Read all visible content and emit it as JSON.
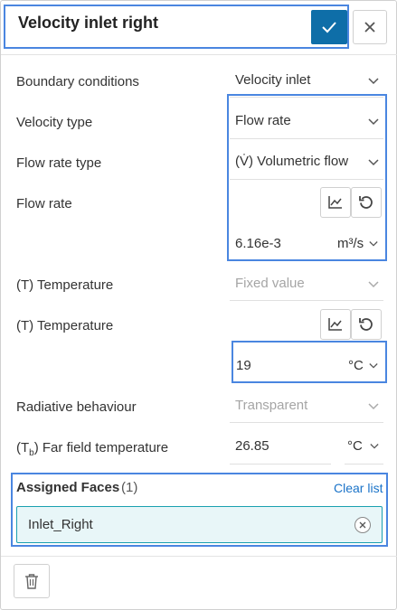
{
  "header": {
    "title": "Velocity inlet right",
    "confirm_icon": "check-icon",
    "close_icon": "close-icon"
  },
  "fields": {
    "boundary_conditions": {
      "label": "Boundary conditions",
      "value": "Velocity inlet"
    },
    "velocity_type": {
      "label": "Velocity type",
      "value": "Flow rate"
    },
    "flow_rate_type": {
      "label": "Flow rate type",
      "value": "(V̇) Volumetric flow"
    },
    "flow_rate": {
      "label": "Flow rate",
      "value": "6.16e-3",
      "unit": "m³/s"
    },
    "temperature_type": {
      "label": "(T) Temperature",
      "value": "Fixed value"
    },
    "temperature": {
      "label": "(T) Temperature",
      "value": "19",
      "unit": "°C"
    },
    "radiative_behaviour": {
      "label": "Radiative behaviour",
      "value": "Transparent"
    },
    "far_field_temperature": {
      "label_prefix": "(T",
      "label_sub": "b",
      "label_suffix": ") Far field temperature",
      "value": "26.85",
      "unit": "°C"
    }
  },
  "assigned_faces": {
    "title": "Assigned Faces",
    "count": "(1)",
    "clear_label": "Clear list",
    "items": [
      {
        "label": "Inlet_Right"
      }
    ]
  },
  "colors": {
    "accent": "#0e6ea8",
    "highlight": "#4a86e0",
    "link": "#1a73c8",
    "chip_bg": "#e8f6f8",
    "chip_border": "#1aa0b0"
  }
}
